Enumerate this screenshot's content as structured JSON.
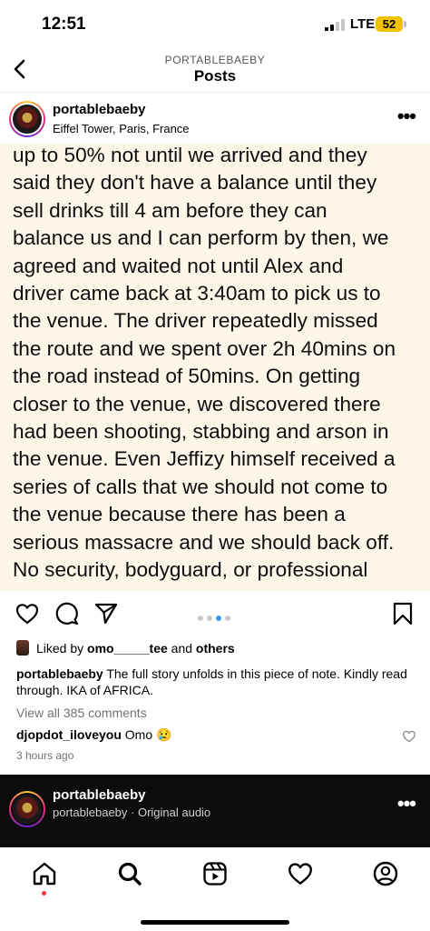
{
  "status_bar": {
    "time": "12:51",
    "network": "LTE",
    "battery": "52",
    "accent": "#f2c200"
  },
  "header": {
    "account": "PORTABLEBAEBY",
    "title": "Posts"
  },
  "post": {
    "username": "portablebaeby",
    "location": "Eiffel Tower, Paris, France",
    "image_text": "up to 50% not until we arrived and they\nsaid they don't have a balance until they\nsell drinks till 4 am before they can\nbalance us and I can perform by then, we\nagreed and waited not until Alex and\ndriver came back at 3:40am to pick us to\nthe venue. The driver repeatedly missed\nthe route and we spent over 2h 40mins on\nthe road instead of 50mins. On getting\ncloser to the venue, we discovered there\nhad been shooting, stabbing and arson in\nthe venue. Even Jeffizy himself received a\nseries of calls that we should not come to\nthe venue because there has been a\nserious massacre and we should back off.\nNo security, bodyguard, or professional",
    "carousel": {
      "count": 4,
      "active_index": 2,
      "active_color": "#3897f0"
    }
  },
  "engagement": {
    "liked_by_prefix": "Liked by ",
    "liked_by_user": "omo_____tee",
    "liked_by_mid": " and ",
    "liked_by_others": "others",
    "caption_user": "portablebaeby",
    "caption_text": " The full story unfolds in this piece of note. Kindly read through. IKA of AFRICA.",
    "view_all": "View all 385 comments",
    "comment_user": "djopdot_iloveyou",
    "comment_text": " Omo 😢",
    "time_ago": "3 hours ago"
  },
  "reel": {
    "username": "portablebaeby",
    "subtitle": "portablebaeby · Original audio"
  },
  "tabs": [
    "home-icon",
    "search-icon",
    "reels-icon",
    "activity-icon",
    "profile-icon"
  ]
}
